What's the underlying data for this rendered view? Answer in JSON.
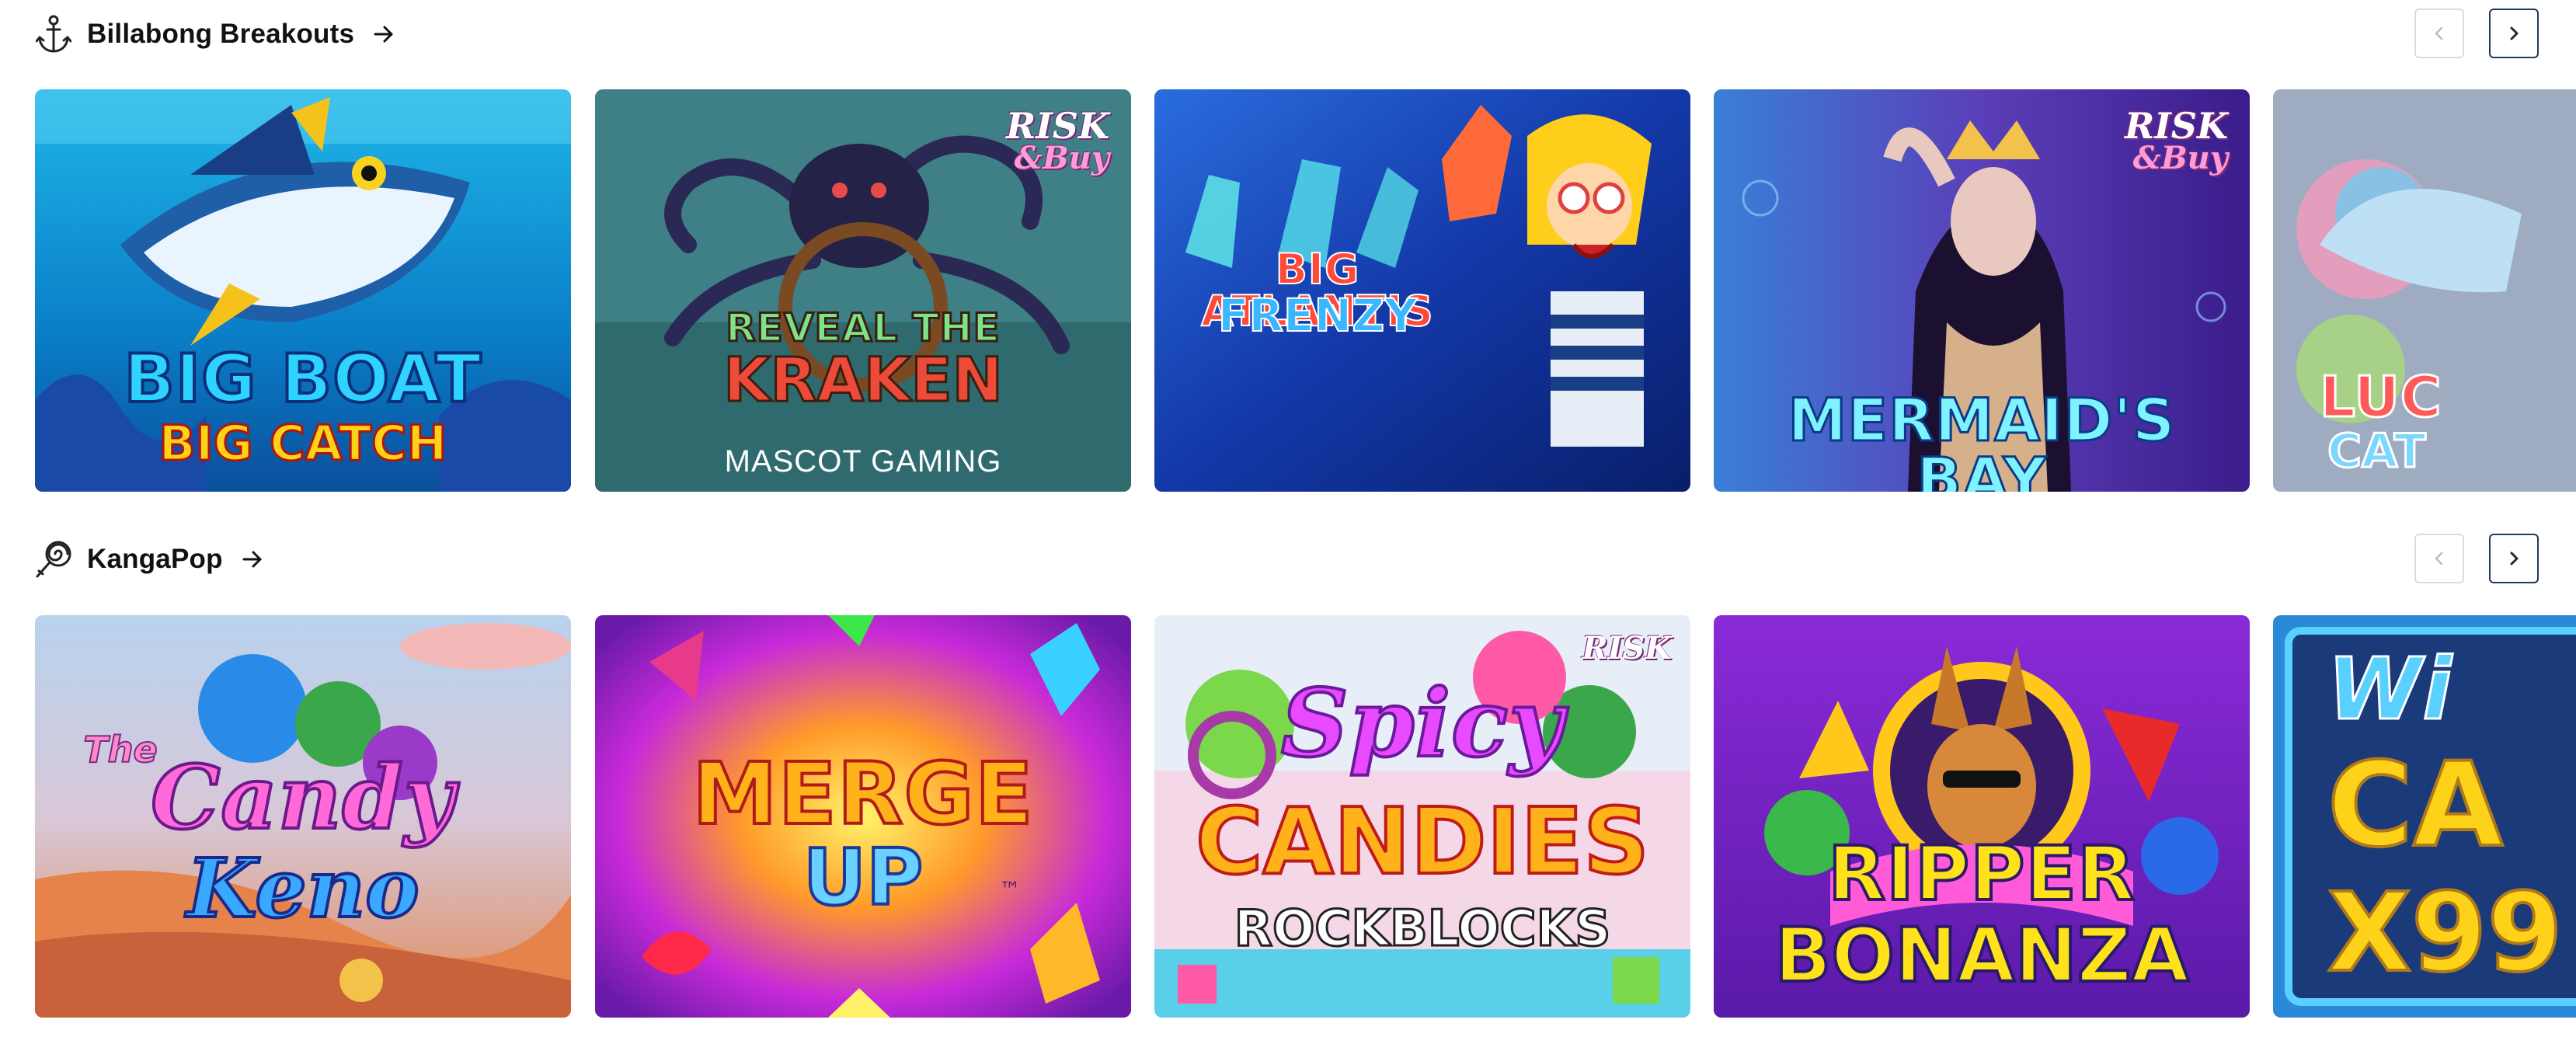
{
  "sections": [
    {
      "title": "Billabong Breakouts",
      "icon": "anchor-icon",
      "games": [
        {
          "title_line1": "BIG BOAT",
          "title_line2": "BIG CATCH",
          "badge_line1": "",
          "badge_line2": "",
          "provider": ""
        },
        {
          "title_line1": "REVEAL THE",
          "title_line2": "KRAKEN",
          "badge_line1": "RISK",
          "badge_line2": "&Buy",
          "provider": "MASCOT GAMING"
        },
        {
          "title_line1": "BIG ATLANTIS",
          "title_line2": "FRENZY",
          "badge_line1": "",
          "badge_line2": "",
          "provider": ""
        },
        {
          "title_line1": "MERMAID'S BAY",
          "title_line2": "",
          "badge_line1": "RISK",
          "badge_line2": "&Buy",
          "provider": ""
        },
        {
          "title_line1": "LUC",
          "title_line2": "CAT",
          "badge_line1": "",
          "badge_line2": "",
          "provider": ""
        }
      ]
    },
    {
      "title": "KangaPop",
      "icon": "lollipop-icon",
      "games": [
        {
          "title_line1": "Candy",
          "title_line2": "Keno",
          "title_prefix": "The",
          "badge_line1": "",
          "badge_line2": "",
          "provider": ""
        },
        {
          "title_line1": "MERGE",
          "title_line2": "UP",
          "badge_line1": "",
          "badge_line2": "",
          "provider": "",
          "tm": "™"
        },
        {
          "title_line1": "Spicy",
          "title_line2": "CANDIES",
          "title_line3": "ROCKBLOCKS",
          "badge_line1": "RISK",
          "badge_line2": "",
          "provider": ""
        },
        {
          "title_line1": "RIPPER",
          "title_line2": "BONANZA",
          "badge_line1": "",
          "badge_line2": "",
          "provider": ""
        },
        {
          "title_line1": "Wi",
          "title_line2": "CA",
          "title_line3": "X99",
          "badge_line1": "",
          "badge_line2": "",
          "provider": ""
        }
      ]
    }
  ],
  "colors": {
    "nav_next_border": "#1f3a5f",
    "nav_prev_border": "#d9dde3",
    "title_text": "#111111"
  }
}
